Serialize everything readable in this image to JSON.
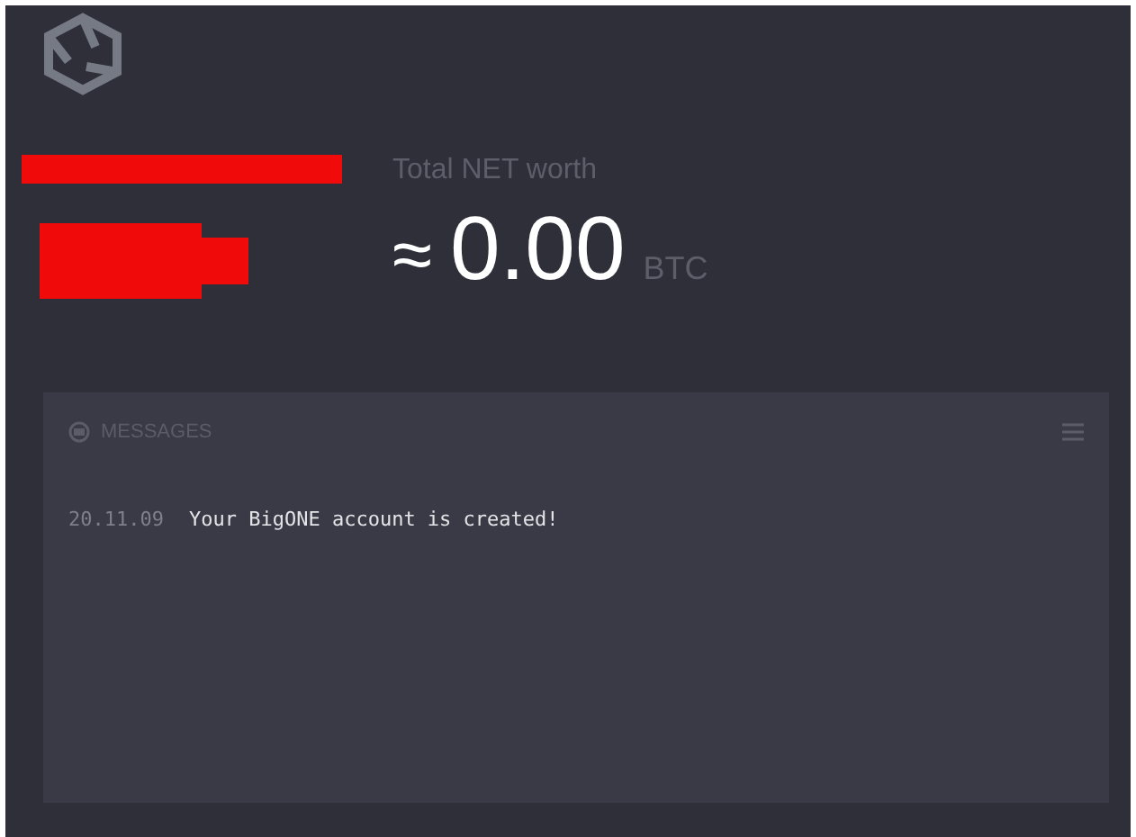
{
  "worth": {
    "label": "Total NET worth",
    "approx": "≈",
    "amount": "0.00",
    "unit": "BTC"
  },
  "messages": {
    "title": "MESSAGES",
    "items": [
      {
        "date": "20.11.09",
        "text": "Your BigONE account is created!"
      }
    ]
  }
}
